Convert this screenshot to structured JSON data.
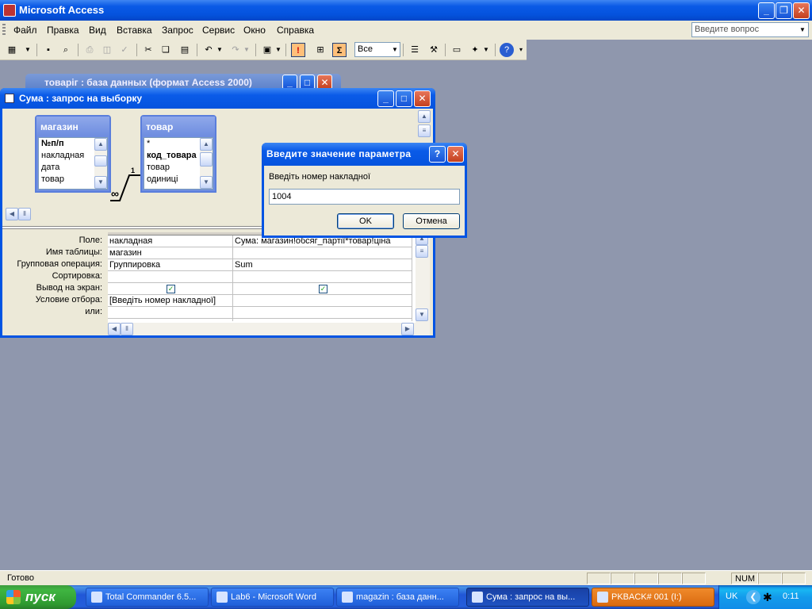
{
  "app": {
    "title": "Microsoft Access"
  },
  "menu": {
    "items": [
      "Файл",
      "Правка",
      "Вид",
      "Вставка",
      "Запрос",
      "Сервис",
      "Окно",
      "Справка"
    ],
    "ask_placeholder": "Введите вопрос"
  },
  "toolbar": {
    "combo_value": "Все"
  },
  "bg_window": {
    "title": "товаріг : база данных (формат Access 2000)"
  },
  "query_window": {
    "title": "Сума : запрос на выборку",
    "tables": [
      {
        "name": "магазин",
        "fields": [
          "№п/п",
          "накладная",
          "дата",
          "товар"
        ]
      },
      {
        "name": "товар",
        "fields": [
          "*",
          "код_товара",
          "товар",
          "одиниці"
        ]
      }
    ],
    "join": {
      "one": "1",
      "many": "∞"
    },
    "grid_labels": [
      "Поле:",
      "Имя таблицы:",
      "Групповая операция:",
      "Сортировка:",
      "Вывод на экран:",
      "Условие отбора:",
      "или:"
    ],
    "columns": [
      {
        "field": "накладная",
        "table": "магазин",
        "group": "Группировка",
        "sort": "",
        "show": "✓",
        "criteria": "[Введіть номер накладної]",
        "or": ""
      },
      {
        "field": "Сума: магазин!обсяг_партії*товар!ціна",
        "table": "",
        "group": "Sum",
        "sort": "",
        "show": "✓",
        "criteria": "",
        "or": ""
      }
    ]
  },
  "dialog": {
    "title": "Введите значение параметра",
    "prompt": "Введіть номер накладної",
    "value": "1004",
    "ok": "OK",
    "cancel": "Отмена"
  },
  "status": {
    "text": "Готово",
    "num": "NUM"
  },
  "taskbar": {
    "start": "пуск",
    "tasks": [
      "Total Commander 6.5...",
      "Lab6 - Microsoft Word",
      "magazin : база данн...",
      "Сума : запрос на вы...",
      "PKBACK# 001 (I:)"
    ],
    "lang": "UK",
    "time": "0:11"
  },
  "colors": {
    "xp_blue": "#0054e3",
    "desktop": "#8f97ad",
    "dialog_face": "#ece9d8"
  },
  "icons": [
    "access-app-icon",
    "minimize-icon",
    "restore-icon",
    "close-icon",
    "help-icon",
    "windows-flag-icon"
  ]
}
